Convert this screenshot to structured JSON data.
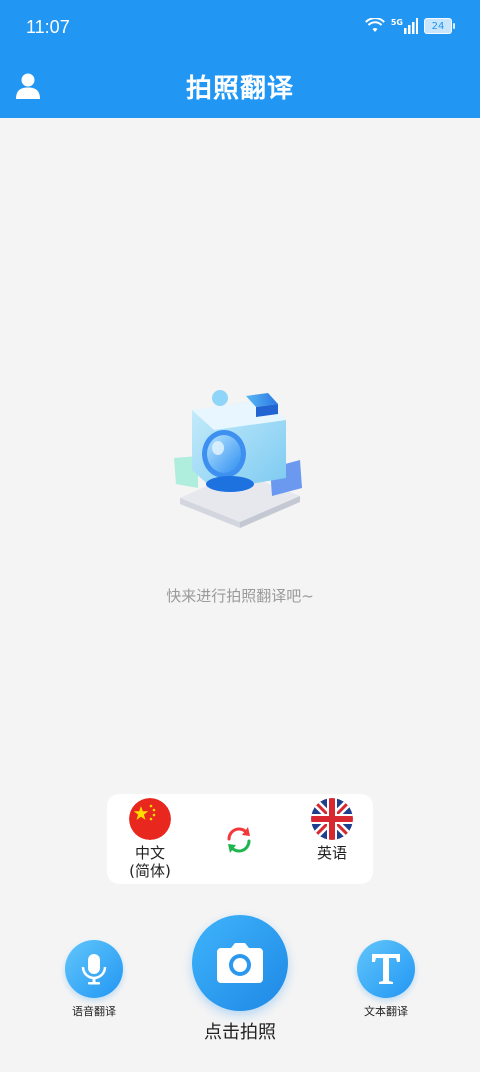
{
  "status_bar": {
    "time": "11:07",
    "network": "5G",
    "battery": "24"
  },
  "header": {
    "title": "拍照翻译"
  },
  "empty_state": {
    "message": "快来进行拍照翻译吧~"
  },
  "languages": {
    "source": "中文\n(简体)",
    "target": "英语"
  },
  "actions": {
    "voice_label": "语音翻译",
    "camera_label": "点击拍照",
    "text_label": "文本翻译"
  },
  "colors": {
    "primary": "#2196f3",
    "background": "#f4f4f4"
  }
}
